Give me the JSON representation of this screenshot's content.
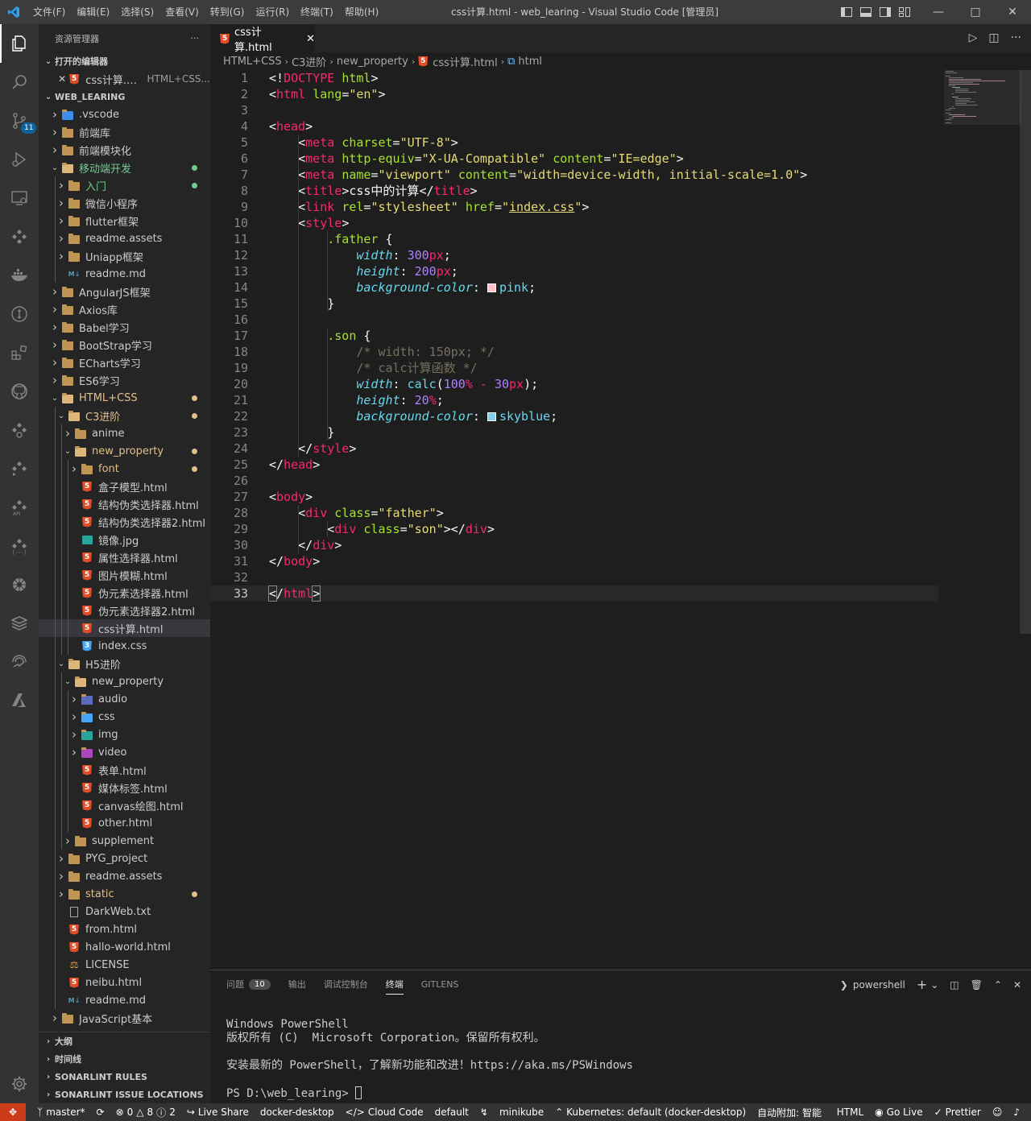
{
  "window": {
    "title": "css计算.html - web_learing - Visual Studio Code [管理员]",
    "menus": [
      "文件(F)",
      "编辑(E)",
      "选择(S)",
      "查看(V)",
      "转到(G)",
      "运行(R)",
      "终端(T)",
      "帮助(H)"
    ]
  },
  "activity": {
    "scm_badge": "11"
  },
  "sidebar": {
    "title": "资源管理器",
    "more": "···",
    "open_editors_label": "打开的编辑器",
    "open_editor": {
      "name": "css计算.html",
      "desc": "HTML+CSS..."
    },
    "workspace_label": "WEB_LEARING",
    "tree": [
      {
        "label": ".vscode",
        "type": "vscode",
        "level": 0,
        "state": "closed"
      },
      {
        "label": "前端库",
        "type": "folder",
        "level": 0,
        "state": "closed"
      },
      {
        "label": "前端模块化",
        "type": "folder",
        "level": 0,
        "state": "closed"
      },
      {
        "label": "移动端开发",
        "type": "folder",
        "level": 0,
        "state": "open",
        "color": "green",
        "dot": "green"
      },
      {
        "label": "入门",
        "type": "folder",
        "level": 1,
        "state": "closed",
        "color": "green",
        "dot": "green"
      },
      {
        "label": "微信小程序",
        "type": "folder",
        "level": 1,
        "state": "closed"
      },
      {
        "label": "flutter框架",
        "type": "folder",
        "level": 1,
        "state": "closed"
      },
      {
        "label": "readme.assets",
        "type": "folder",
        "level": 1,
        "state": "closed"
      },
      {
        "label": "Uniapp框架",
        "type": "folder",
        "level": 1,
        "state": "closed"
      },
      {
        "label": "readme.md",
        "type": "md",
        "level": 1,
        "state": "none"
      },
      {
        "label": "AngularJS框架",
        "type": "folder",
        "level": 0,
        "state": "closed"
      },
      {
        "label": "Axios库",
        "type": "folder",
        "level": 0,
        "state": "closed"
      },
      {
        "label": "Babel学习",
        "type": "folder",
        "level": 0,
        "state": "closed"
      },
      {
        "label": "BootStrap学习",
        "type": "folder",
        "level": 0,
        "state": "closed"
      },
      {
        "label": "ECharts学习",
        "type": "folder",
        "level": 0,
        "state": "closed"
      },
      {
        "label": "ES6学习",
        "type": "folder",
        "level": 0,
        "state": "closed"
      },
      {
        "label": "HTML+CSS",
        "type": "folder",
        "level": 0,
        "state": "open",
        "color": "mod",
        "dot": "mod"
      },
      {
        "label": "C3进阶",
        "type": "folder",
        "level": 1,
        "state": "open",
        "color": "mod",
        "dot": "mod"
      },
      {
        "label": "anime",
        "type": "folder",
        "level": 2,
        "state": "closed"
      },
      {
        "label": "new_property",
        "type": "folder",
        "level": 2,
        "state": "open",
        "color": "mod",
        "dot": "mod"
      },
      {
        "label": "font",
        "type": "folder",
        "level": 3,
        "state": "closed",
        "color": "mod",
        "dot": "mod"
      },
      {
        "label": "盒子模型.html",
        "type": "html",
        "level": 3,
        "state": "none"
      },
      {
        "label": "结构伪类选择器.html",
        "type": "html",
        "level": 3,
        "state": "none"
      },
      {
        "label": "结构伪类选择器2.html",
        "type": "html",
        "level": 3,
        "state": "none"
      },
      {
        "label": "镜像.jpg",
        "type": "img",
        "level": 3,
        "state": "none"
      },
      {
        "label": "属性选择器.html",
        "type": "html",
        "level": 3,
        "state": "none"
      },
      {
        "label": "图片模糊.html",
        "type": "html",
        "level": 3,
        "state": "none"
      },
      {
        "label": "伪元素选择器.html",
        "type": "html",
        "level": 3,
        "state": "none"
      },
      {
        "label": "伪元素选择器2.html",
        "type": "html",
        "level": 3,
        "state": "none"
      },
      {
        "label": "css计算.html",
        "type": "html",
        "level": 3,
        "state": "none",
        "selected": true
      },
      {
        "label": "index.css",
        "type": "css",
        "level": 3,
        "state": "none"
      },
      {
        "label": "H5进阶",
        "type": "folder",
        "level": 1,
        "state": "open"
      },
      {
        "label": "new_property",
        "type": "folder",
        "level": 2,
        "state": "open"
      },
      {
        "label": "audio",
        "type": "audio",
        "level": 3,
        "state": "closed"
      },
      {
        "label": "css",
        "type": "cssfolder",
        "level": 3,
        "state": "closed"
      },
      {
        "label": "img",
        "type": "imgfolder",
        "level": 3,
        "state": "closed"
      },
      {
        "label": "video",
        "type": "video",
        "level": 3,
        "state": "closed"
      },
      {
        "label": "表单.html",
        "type": "html",
        "level": 3,
        "state": "none"
      },
      {
        "label": "媒体标签.html",
        "type": "html",
        "level": 3,
        "state": "none"
      },
      {
        "label": "canvas绘图.html",
        "type": "html",
        "level": 3,
        "state": "none"
      },
      {
        "label": "other.html",
        "type": "html",
        "level": 3,
        "state": "none"
      },
      {
        "label": "supplement",
        "type": "folder",
        "level": 2,
        "state": "closed"
      },
      {
        "label": "PYG_project",
        "type": "folder",
        "level": 1,
        "state": "closed"
      },
      {
        "label": "readme.assets",
        "type": "folder",
        "level": 1,
        "state": "closed"
      },
      {
        "label": "static",
        "type": "folder",
        "level": 1,
        "state": "closed",
        "color": "mod",
        "dot": "mod"
      },
      {
        "label": "DarkWeb.txt",
        "type": "txt",
        "level": 1,
        "state": "none"
      },
      {
        "label": "from.html",
        "type": "html",
        "level": 1,
        "state": "none"
      },
      {
        "label": "hallo-world.html",
        "type": "html",
        "level": 1,
        "state": "none"
      },
      {
        "label": "LICENSE",
        "type": "license",
        "level": 1,
        "state": "none"
      },
      {
        "label": "neibu.html",
        "type": "html",
        "level": 1,
        "state": "none"
      },
      {
        "label": "readme.md",
        "type": "md",
        "level": 1,
        "state": "none"
      },
      {
        "label": "JavaScript基本",
        "type": "folder",
        "level": 0,
        "state": "closed"
      }
    ],
    "bottom_sections": [
      "大纲",
      "时间线",
      "SONARLINT RULES",
      "SONARLINT ISSUE LOCATIONS"
    ]
  },
  "editor": {
    "tab_label": "css计算.html",
    "breadcrumb": [
      "HTML+CSS",
      "C3进阶",
      "new_property",
      "css计算.html",
      "html"
    ],
    "lines": [
      [
        [
          "k-bracket",
          "<!"
        ],
        [
          "k-tag",
          "DOCTYPE"
        ],
        [
          "k-plain",
          " "
        ],
        [
          "k-attr",
          "html"
        ],
        [
          "k-bracket",
          ">"
        ]
      ],
      [
        [
          "k-bracket",
          "<"
        ],
        [
          "k-tag",
          "html"
        ],
        [
          "k-plain",
          " "
        ],
        [
          "k-attr",
          "lang"
        ],
        [
          "k-plain",
          "="
        ],
        [
          "k-str",
          "\"en\""
        ],
        [
          "k-bracket",
          ">"
        ]
      ],
      [],
      [
        [
          "k-bracket",
          "<"
        ],
        [
          "k-tag",
          "head"
        ],
        [
          "k-bracket",
          ">"
        ]
      ],
      [
        [
          "k-plain",
          "    "
        ],
        [
          "k-bracket",
          "<"
        ],
        [
          "k-tag",
          "meta"
        ],
        [
          "k-plain",
          " "
        ],
        [
          "k-attr",
          "charset"
        ],
        [
          "k-plain",
          "="
        ],
        [
          "k-str",
          "\"UTF-8\""
        ],
        [
          "k-bracket",
          ">"
        ]
      ],
      [
        [
          "k-plain",
          "    "
        ],
        [
          "k-bracket",
          "<"
        ],
        [
          "k-tag",
          "meta"
        ],
        [
          "k-plain",
          " "
        ],
        [
          "k-attr",
          "http-equiv"
        ],
        [
          "k-plain",
          "="
        ],
        [
          "k-str",
          "\"X-UA-Compatible\""
        ],
        [
          "k-plain",
          " "
        ],
        [
          "k-attr",
          "content"
        ],
        [
          "k-plain",
          "="
        ],
        [
          "k-str",
          "\"IE=edge\""
        ],
        [
          "k-bracket",
          ">"
        ]
      ],
      [
        [
          "k-plain",
          "    "
        ],
        [
          "k-bracket",
          "<"
        ],
        [
          "k-tag",
          "meta"
        ],
        [
          "k-plain",
          " "
        ],
        [
          "k-attr",
          "name"
        ],
        [
          "k-plain",
          "="
        ],
        [
          "k-str",
          "\"viewport\""
        ],
        [
          "k-plain",
          " "
        ],
        [
          "k-attr",
          "content"
        ],
        [
          "k-plain",
          "="
        ],
        [
          "k-str",
          "\"width=device-width, initial-scale=1.0\""
        ],
        [
          "k-bracket",
          ">"
        ]
      ],
      [
        [
          "k-plain",
          "    "
        ],
        [
          "k-bracket",
          "<"
        ],
        [
          "k-tag",
          "title"
        ],
        [
          "k-bracket",
          ">"
        ],
        [
          "k-plain",
          "css中的计算"
        ],
        [
          "k-bracket",
          "</"
        ],
        [
          "k-tag",
          "title"
        ],
        [
          "k-bracket",
          ">"
        ]
      ],
      [
        [
          "k-plain",
          "    "
        ],
        [
          "k-bracket",
          "<"
        ],
        [
          "k-tag",
          "link"
        ],
        [
          "k-plain",
          " "
        ],
        [
          "k-attr",
          "rel"
        ],
        [
          "k-plain",
          "="
        ],
        [
          "k-str",
          "\"stylesheet\""
        ],
        [
          "k-plain",
          " "
        ],
        [
          "k-attr",
          "href"
        ],
        [
          "k-plain",
          "="
        ],
        [
          "k-str",
          "\""
        ],
        [
          "k-str-u",
          "index.css"
        ],
        [
          "k-str",
          "\""
        ],
        [
          "k-bracket",
          ">"
        ]
      ],
      [
        [
          "k-plain",
          "    "
        ],
        [
          "k-bracket",
          "<"
        ],
        [
          "k-tag",
          "style"
        ],
        [
          "k-bracket",
          ">"
        ]
      ],
      [
        [
          "k-plain",
          "        "
        ],
        [
          "k-sel",
          ".father"
        ],
        [
          "k-plain",
          " {"
        ]
      ],
      [
        [
          "k-plain",
          "            "
        ],
        [
          "k-prop",
          "width"
        ],
        [
          "k-plain",
          ": "
        ],
        [
          "k-num",
          "300"
        ],
        [
          "k-unit",
          "px"
        ],
        [
          "k-plain",
          ";"
        ]
      ],
      [
        [
          "k-plain",
          "            "
        ],
        [
          "k-prop",
          "height"
        ],
        [
          "k-plain",
          ": "
        ],
        [
          "k-num",
          "200"
        ],
        [
          "k-unit",
          "px"
        ],
        [
          "k-plain",
          ";"
        ]
      ],
      [
        [
          "k-plain",
          "            "
        ],
        [
          "k-prop",
          "background-color"
        ],
        [
          "k-plain",
          ": "
        ],
        [
          "swatch-pink",
          ""
        ],
        [
          "k-fn",
          "pink"
        ],
        [
          "k-plain",
          ";"
        ]
      ],
      [
        [
          "k-plain",
          "        }"
        ]
      ],
      [],
      [
        [
          "k-plain",
          "        "
        ],
        [
          "k-sel",
          ".son"
        ],
        [
          "k-plain",
          " {"
        ]
      ],
      [
        [
          "k-plain",
          "            "
        ],
        [
          "k-cmt",
          "/* width: 150px; */"
        ]
      ],
      [
        [
          "k-plain",
          "            "
        ],
        [
          "k-cmt",
          "/* calc计算函数 */"
        ]
      ],
      [
        [
          "k-plain",
          "            "
        ],
        [
          "k-prop",
          "width"
        ],
        [
          "k-plain",
          ": "
        ],
        [
          "k-fn",
          "calc"
        ],
        [
          "k-plain",
          "("
        ],
        [
          "k-num",
          "100"
        ],
        [
          "k-unit",
          "%"
        ],
        [
          "k-plain",
          " "
        ],
        [
          "k-unit",
          "-"
        ],
        [
          "k-plain",
          " "
        ],
        [
          "k-num",
          "30"
        ],
        [
          "k-unit",
          "px"
        ],
        [
          "k-plain",
          ");"
        ]
      ],
      [
        [
          "k-plain",
          "            "
        ],
        [
          "k-prop",
          "height"
        ],
        [
          "k-plain",
          ": "
        ],
        [
          "k-num",
          "20"
        ],
        [
          "k-unit",
          "%"
        ],
        [
          "k-plain",
          ";"
        ]
      ],
      [
        [
          "k-plain",
          "            "
        ],
        [
          "k-prop",
          "background-color"
        ],
        [
          "k-plain",
          ": "
        ],
        [
          "swatch-skyblue",
          ""
        ],
        [
          "k-fn",
          "skyblue"
        ],
        [
          "k-plain",
          ";"
        ]
      ],
      [
        [
          "k-plain",
          "        }"
        ]
      ],
      [
        [
          "k-plain",
          "    "
        ],
        [
          "k-bracket",
          "</"
        ],
        [
          "k-tag",
          "style"
        ],
        [
          "k-bracket",
          ">"
        ]
      ],
      [
        [
          "k-bracket",
          "</"
        ],
        [
          "k-tag",
          "head"
        ],
        [
          "k-bracket",
          ">"
        ]
      ],
      [],
      [
        [
          "k-bracket",
          "<"
        ],
        [
          "k-tag",
          "body"
        ],
        [
          "k-bracket",
          ">"
        ]
      ],
      [
        [
          "k-plain",
          "    "
        ],
        [
          "k-bracket",
          "<"
        ],
        [
          "k-tag",
          "div"
        ],
        [
          "k-plain",
          " "
        ],
        [
          "k-attr",
          "class"
        ],
        [
          "k-plain",
          "="
        ],
        [
          "k-str",
          "\"father\""
        ],
        [
          "k-bracket",
          ">"
        ]
      ],
      [
        [
          "k-plain",
          "        "
        ],
        [
          "k-bracket",
          "<"
        ],
        [
          "k-tag",
          "div"
        ],
        [
          "k-plain",
          " "
        ],
        [
          "k-attr",
          "class"
        ],
        [
          "k-plain",
          "="
        ],
        [
          "k-str",
          "\"son\""
        ],
        [
          "k-bracket",
          "></"
        ],
        [
          "k-tag",
          "div"
        ],
        [
          "k-bracket",
          ">"
        ]
      ],
      [
        [
          "k-plain",
          "    "
        ],
        [
          "k-bracket",
          "</"
        ],
        [
          "k-tag",
          "div"
        ],
        [
          "k-bracket",
          ">"
        ]
      ],
      [
        [
          "k-bracket",
          "</"
        ],
        [
          "k-tag",
          "body"
        ],
        [
          "k-bracket",
          ">"
        ]
      ],
      [],
      [
        [
          "k-bracket-box",
          "<"
        ],
        [
          "k-bracket",
          "/"
        ],
        [
          "k-tag",
          "html"
        ],
        [
          "k-bracket-box",
          ">"
        ]
      ]
    ],
    "current_line": 33
  },
  "panel": {
    "tabs": [
      "问题",
      "输出",
      "调试控制台",
      "终端",
      "GITLENS"
    ],
    "active_tab": "终端",
    "problems_count": "10",
    "shell": "powershell",
    "terminal_lines": [
      "Windows PowerShell",
      "版权所有 (C)  Microsoft Corporation。保留所有权利。",
      "",
      "安装最新的 PowerShell，了解新功能和改进！https://aka.ms/PSWindows",
      "",
      "PS D:\\web_learing> "
    ]
  },
  "status": {
    "branch": "master*",
    "errors": "0",
    "warnings": "8",
    "info": "2",
    "live_share": "Live Share",
    "docker": "docker-desktop",
    "cloud_code": "Cloud Code",
    "default": "default",
    "minikube": "minikube",
    "kubernetes": "Kubernetes: default (docker-desktop)",
    "auto_attach": "自动附加: 智能",
    "language": "HTML",
    "go_live": "Go Live",
    "prettier": "Prettier"
  },
  "colors": {
    "accent": "#007acc",
    "remote": "#cd3c1a",
    "modified": "#e2c08d",
    "added": "#73c991",
    "pink_swatch": "#ffc0cb",
    "skyblue_swatch": "#87ceeb"
  }
}
